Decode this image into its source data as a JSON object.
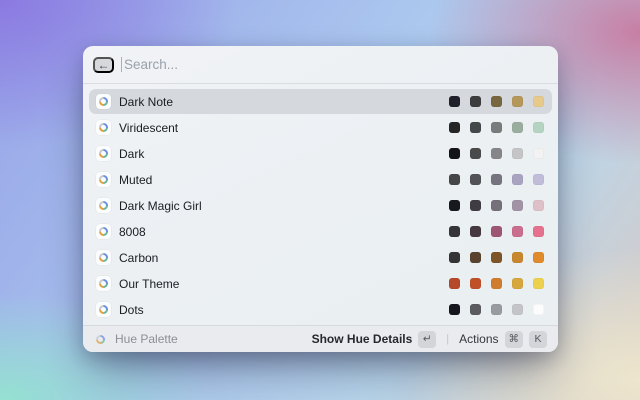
{
  "search": {
    "placeholder": "Search..."
  },
  "icons": {
    "back": "←",
    "return_key": "↵",
    "command_key": "⌘",
    "divider": "|"
  },
  "list": {
    "items": [
      {
        "label": "Dark Note",
        "selected": true,
        "swatches": [
          "#20202a",
          "#3d3d3d",
          "#77663f",
          "#b5975a",
          "#e7ca8b"
        ]
      },
      {
        "label": "Viridescent",
        "selected": false,
        "swatches": [
          "#252525",
          "#434848",
          "#767d7b",
          "#9aad9f",
          "#b5d3c1"
        ]
      },
      {
        "label": "Dark",
        "selected": false,
        "swatches": [
          "#141418",
          "#4a4a4a",
          "#868689",
          "#c5c5c7",
          "#f2f2f2"
        ]
      },
      {
        "label": "Muted",
        "selected": false,
        "swatches": [
          "#464649",
          "#525257",
          "#76747f",
          "#a9a3c2",
          "#c0bcda"
        ]
      },
      {
        "label": "Dark Magic Girl",
        "selected": false,
        "swatches": [
          "#18181f",
          "#403c44",
          "#757079",
          "#a292a6",
          "#dec0c8"
        ]
      },
      {
        "label": "8008",
        "selected": false,
        "swatches": [
          "#353439",
          "#45393f",
          "#9d5673",
          "#ca6e8d",
          "#e5718f"
        ]
      },
      {
        "label": "Carbon",
        "selected": false,
        "swatches": [
          "#343434",
          "#59432e",
          "#7d5426",
          "#c8872f",
          "#e08a2b"
        ]
      },
      {
        "label": "Our Theme",
        "selected": false,
        "swatches": [
          "#b5492a",
          "#c05028",
          "#d07c2f",
          "#d6a73c",
          "#edd14e"
        ]
      },
      {
        "label": "Dots",
        "selected": false,
        "swatches": [
          "#16161e",
          "#5b5b60",
          "#999ba0",
          "#c5c5c9",
          "#fcfcfc"
        ]
      }
    ]
  },
  "footer": {
    "source_label": "Hue Palette",
    "primary_action_label": "Show Hue Details",
    "primary_action_key": "↵",
    "actions_label": "Actions",
    "actions_keys": [
      "⌘",
      "K"
    ]
  },
  "colors": {
    "selection_highlight": "#d5d8dc",
    "window_background": "#eff2f5",
    "footer_background": "#e9ebee"
  }
}
